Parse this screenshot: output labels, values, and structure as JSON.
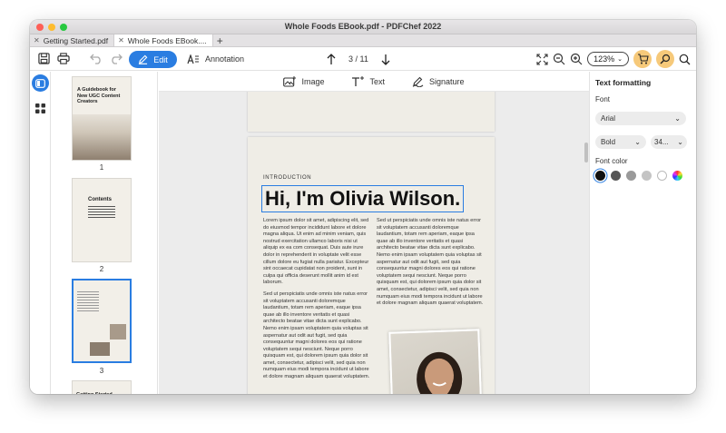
{
  "window": {
    "title": "Whole Foods EBook.pdf - PDFChef 2022"
  },
  "tabs": [
    {
      "label": "Getting Started.pdf"
    },
    {
      "label": "Whole Foods EBook...."
    }
  ],
  "toolbar": {
    "edit_label": "Edit",
    "annotation_label": "Annotation",
    "page_indicator": "3 / 11",
    "zoom_value": "123%"
  },
  "subtoolbar": {
    "image_label": "Image",
    "text_label": "Text",
    "signature_label": "Signature"
  },
  "thumbnails": [
    {
      "number": "1",
      "title": "A Guidebook for New UGC Content Creators"
    },
    {
      "number": "2",
      "title": "Contents"
    },
    {
      "number": "3"
    },
    {
      "title": "Getting Started"
    }
  ],
  "page": {
    "eyebrow": "INTRODUCTION",
    "heading": "Hi, I'm Olivia Wilson.",
    "left_col_p1": "Lorem ipsum dolor sit amet, adipiscing elit, sed do eiusmod tempor incididunt labore et dolore magna aliqua. Ut enim ad minim veniam, quis nostrud exercitation ullamco laboris nisi ut aliquip ex ea com consequat. Duis aute irure dolor in reprehenderit in voluptate velit esse cillum dolore eu fugiat nulla pariatur. Excepteur sint occaecat cupidatat non proident, sunt in culpa qui officia deserunt mollit anim id est laborum.",
    "left_col_p2": "Sed ut perspiciatis unde omnis iste natus error sit voluptatem accusanti doloremque laudantium, totam rem aperiam, eaque ipsa quae ab illo inventore veritatis et quasi architecto beatae vitae dicta sunt explicabo. Nemo enim ipsam voluptatem quia voluptas sit aspernatur aut odit aut fugit, sed quia consequuntur magni dolores eos qui ratione voluptatem sequi nesciunt. Neque porro quisquam est, qui dolorem ipsum quia dolor sit amet, consectetur, adipisci velit, sed quia non numquam eius modi tempora incidunt ut labore et dolore magnam aliquam quaerat voluptatem.",
    "right_col_p1": "Sed ut perspiciatis unde omnis iste natus error sit voluptatem accusanti doloremque laudantium, totam rem aperiam, eaque ipsa quae ab illo inventore veritatis et quasi architecto beatae vitae dicta sunt explicabo. Nemo enim ipsam voluptatem quia voluptas sit aspernatur aut odit aut fugit, sed quia consequuntur magni dolores eos qui ratione voluptatem sequi nesciunt. Neque porro quisquam est, qui dolorem ipsum quia dolor sit amet, consectetur, adipisci velit, sed quia non numquam eius modi tempora incidunt ut labore et dolore magnam aliquam quaerat voluptatem."
  },
  "text_formatting": {
    "title": "Text formatting",
    "font_label": "Font",
    "font_value": "Arial",
    "weight_value": "Bold",
    "size_value": "34...",
    "color_label": "Font color",
    "colors": [
      "#111111",
      "#555555",
      "#9a9a9a",
      "#c4c4c4",
      "#ffffff"
    ],
    "selected_color": "#111111"
  },
  "colors": {
    "accent": "#2a7de1",
    "highlight": "#f6c97a"
  }
}
